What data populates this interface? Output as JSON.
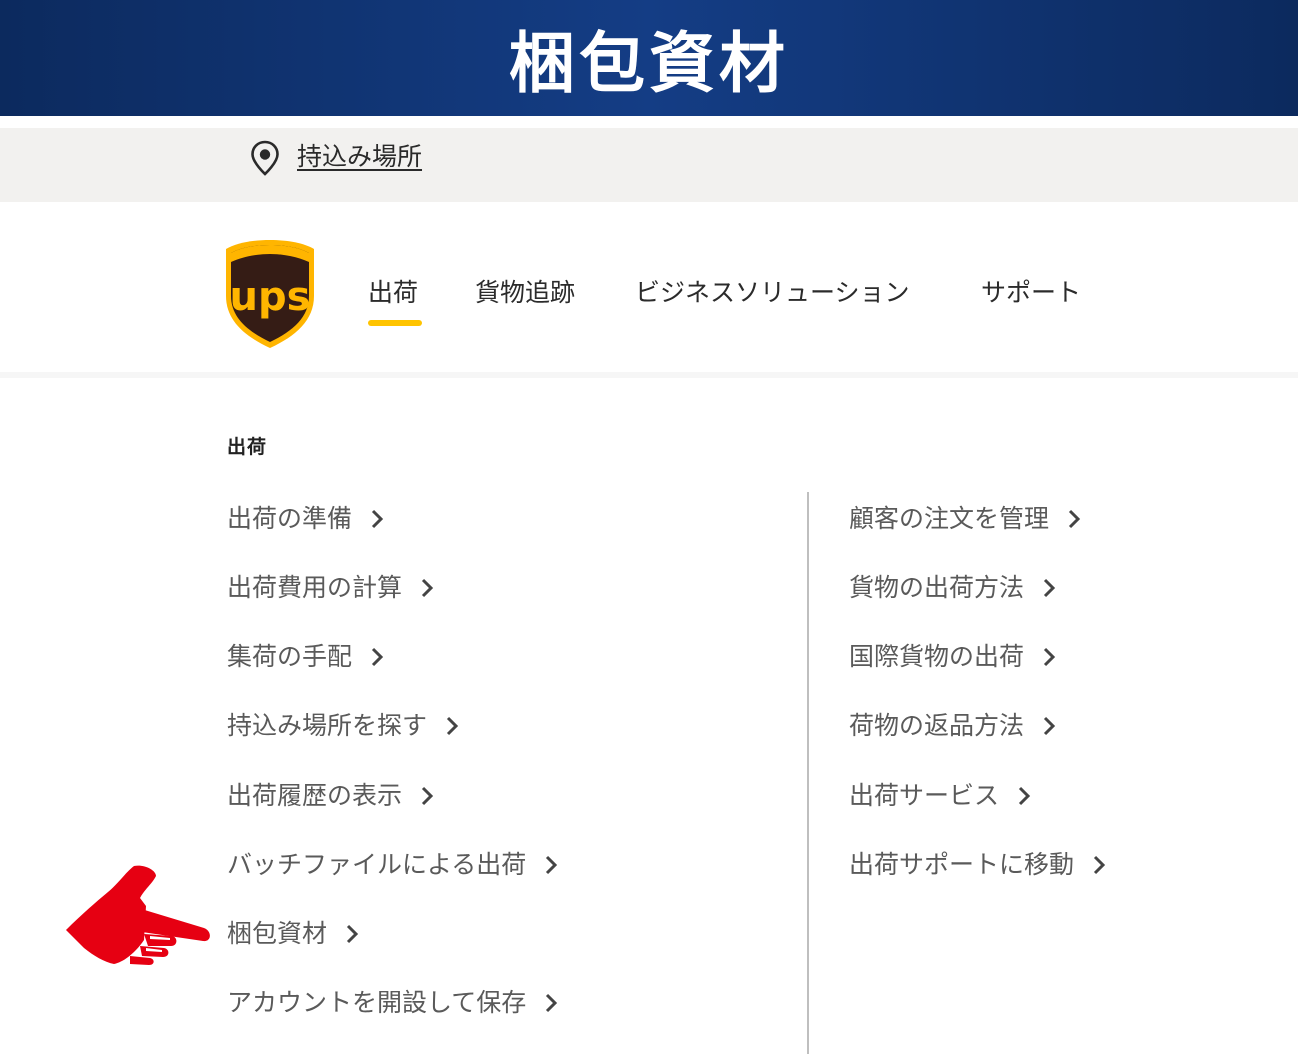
{
  "banner": {
    "title": "梱包資材"
  },
  "location_bar": {
    "link_label": "持込み場所",
    "icon": "location-pin-icon"
  },
  "brand": {
    "logo_text": "ups",
    "logo_colors": {
      "shield": "#351c15",
      "accent": "#ffb500"
    }
  },
  "nav": {
    "items": [
      {
        "label": "出荷",
        "active": true
      },
      {
        "label": "貨物追跡",
        "active": false
      },
      {
        "label": "ビジネスソリューション",
        "active": false
      },
      {
        "label": "サポート",
        "active": false
      }
    ],
    "active_color": "#ffc400"
  },
  "menu": {
    "section_label": "出荷",
    "left_items": [
      "出荷の準備",
      "出荷費用の計算",
      "集荷の手配",
      "持込み場所を探す",
      "出荷履歴の表示",
      "バッチファイルによる出荷",
      "梱包資材",
      "アカウントを開設して保存"
    ],
    "right_items": [
      "顧客の注文を管理",
      "貨物の出荷方法",
      "国際貨物の出荷",
      "荷物の返品方法",
      "出荷サービス",
      "出荷サポートに移動"
    ],
    "highlighted_item": "梱包資材",
    "pointer_icon": "pointing-hand-icon",
    "pointer_color": "#e60012"
  }
}
